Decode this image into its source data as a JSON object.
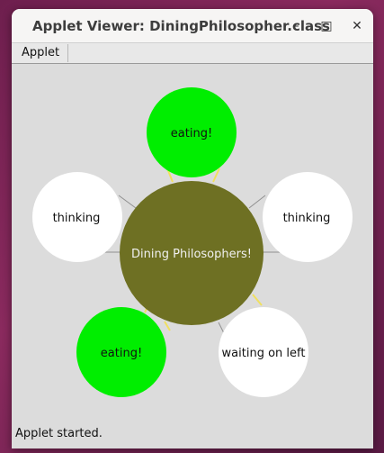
{
  "window": {
    "title": "Applet Viewer: DiningPhilosopher.class",
    "controls": {
      "minimize": "–",
      "maximize": "□",
      "close": "✕"
    }
  },
  "menubar": {
    "items": [
      {
        "label": "Applet"
      }
    ]
  },
  "applet": {
    "center_label": "Dining Philosophers!",
    "philosophers": [
      {
        "state": "eating!",
        "color": "#00ee00"
      },
      {
        "state": "thinking",
        "color": "#ffffff"
      },
      {
        "state": "waiting on left",
        "color": "#ffffff"
      },
      {
        "state": "eating!",
        "color": "#00ee00"
      },
      {
        "state": "thinking",
        "color": "#ffffff"
      }
    ],
    "table_color": "#6e7023",
    "background": "#dcdcdc"
  },
  "status": "Applet started."
}
